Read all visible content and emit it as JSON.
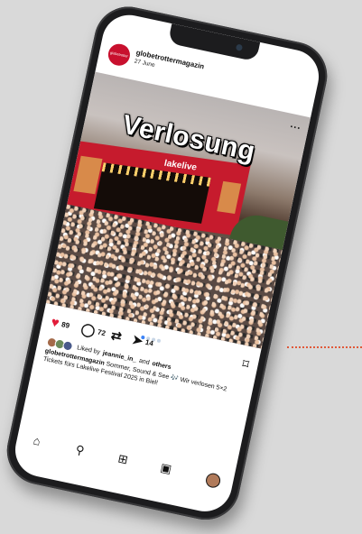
{
  "post": {
    "username": "globetrottermagazin",
    "date": "27 June",
    "avatar_text": "globetrotter",
    "more": "...",
    "overlay_title": "Verlosung",
    "stage_label": "lakelive"
  },
  "actions": {
    "likes": "89",
    "comments": "72",
    "shares": "14"
  },
  "liked_by": {
    "prefix": "Liked by",
    "user": "jeannie_in_",
    "middle": "and",
    "others": "others"
  },
  "caption": {
    "user": "globetrottermagazin",
    "text": "Sommer, Sound & See 🎶 Wir verlosen 5×2 Tickets fürs Lakelive Festival 2025 in Biel!"
  },
  "colors": {
    "heart": "#e21d3a",
    "stage": "#c61b2d",
    "dotted_line": "#e05a3a"
  },
  "icons": {
    "heart": "heart-icon",
    "comment": "comment-icon",
    "repost": "repost-icon",
    "share": "share-icon",
    "save": "bookmark-icon",
    "home": "home-icon",
    "search": "search-icon",
    "create": "create-icon",
    "reels": "reels-icon",
    "profile": "profile-icon"
  }
}
